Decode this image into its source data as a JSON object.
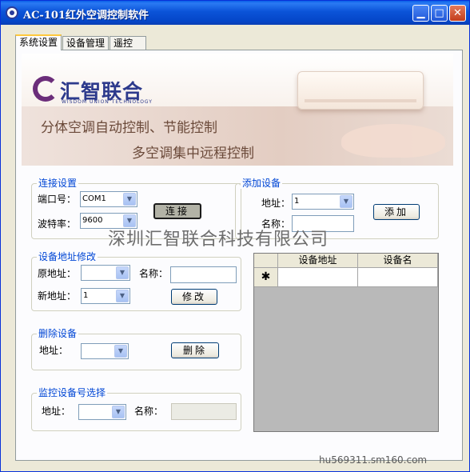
{
  "window": {
    "title": "AC-101红外空调控制软件",
    "minimize_glyph": "▁",
    "maximize_glyph": "□",
    "close_glyph": "✕"
  },
  "tabs": [
    {
      "label": "系统设置",
      "active": true
    },
    {
      "label": "设备管理",
      "active": false
    },
    {
      "label": "遥控",
      "active": false
    }
  ],
  "banner": {
    "logo_text": "汇智联合",
    "logo_subtitle": "WISDOM UNION TECHNOLOGY",
    "line1": "分体空调自动控制、节能控制",
    "line2": "多空调集中远程控制"
  },
  "connection": {
    "title": "连接设置",
    "port_label": "端口号：",
    "port_value": "COM1",
    "baud_label": "波特率：",
    "baud_value": "9600",
    "connect_button": "连接"
  },
  "add_device": {
    "title": "添加设备",
    "address_label": "地址：",
    "address_value": "1",
    "name_label": "名称：",
    "name_value": "",
    "add_button": "添加"
  },
  "modify_address": {
    "title": "设备地址修改",
    "old_label": "原地址：",
    "old_value": "",
    "name_label": "名称：",
    "name_value": "",
    "new_label": "新地址：",
    "new_value": "1",
    "modify_button": "修改"
  },
  "delete_device": {
    "title": "删除设备",
    "address_label": "地址：",
    "address_value": "",
    "delete_button": "删除"
  },
  "monitor": {
    "title": "监控设备号选择",
    "address_label": "地址：",
    "address_value": "",
    "name_label": "名称：",
    "name_value": ""
  },
  "device_table": {
    "columns": [
      "设备地址",
      "设备名"
    ],
    "new_row_marker": "✱",
    "rows": []
  },
  "watermark": "深圳汇智联合科技有限公司",
  "footer_watermark": "hu569311.sm160.com",
  "colors": {
    "title_bar": "#0a5ee8",
    "group_title": "#0046d5",
    "panel": "#fcfcfe",
    "window_face": "#ece9d8"
  }
}
